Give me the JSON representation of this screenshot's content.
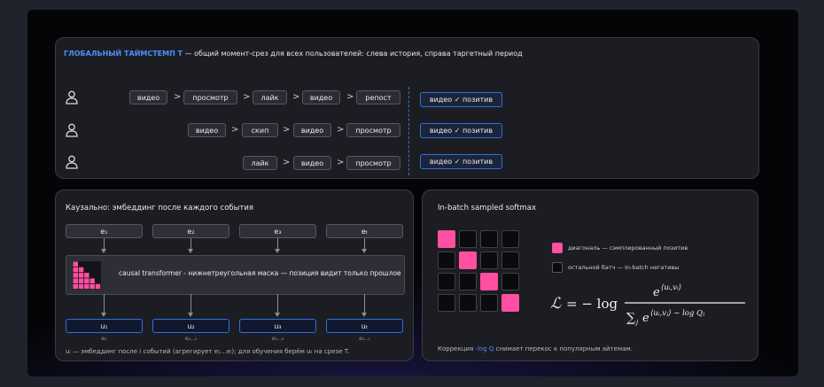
{
  "header": {
    "accent": "ГЛОБАЛЬНЫЙ ТАЙМСТЕМП T",
    "rest": " — общий момент-срез для всех пользователей: слева история, справа таргетный период"
  },
  "users": [
    {
      "events": [
        "видео",
        "просмотр",
        "лайк",
        "видео",
        "репост"
      ],
      "target": "видео ✓ позитив"
    },
    {
      "events": [
        "видео",
        "скип",
        "видео",
        "просмотр"
      ],
      "target": "видео ✓ позитив"
    },
    {
      "events": [
        "лайк",
        "видео",
        "просмотр"
      ],
      "target": "видео ✓ позитив"
    }
  ],
  "causal": {
    "title": "Каузально: эмбеддинг после каждого события",
    "inputs": [
      "e₁",
      "e₂",
      "e₃",
      "eₜ"
    ],
    "transformer_label": "causal transformer - нижнетреугольная маска — позиция видит только прошлое",
    "outputs": [
      "u₁",
      "u₂",
      "u₃",
      "uₜ"
    ],
    "output_subs": [
      "e₁",
      "e₁..₂",
      "e₁..₃",
      "e₁..ₜ"
    ],
    "footer": "uᵢ — эмбеддинг после i событий (агрегирует e₁…eᵢ); для обучения берём uₜ на срезе T."
  },
  "softmax": {
    "title": "In-batch sampled softmax",
    "grid_size": 4,
    "legend": [
      {
        "color": "#ff4fa0",
        "label": "диагональ — сэмплированный позитив"
      },
      {
        "color": "#0b0b0e",
        "label": "остальной батч — in-batch негативы"
      }
    ],
    "footer_pre": "Коррекция ",
    "footer_accent": "-log Q",
    "footer_post": " снимает перекос к популярным айтемам."
  },
  "colors": {
    "accent": "#4d8dff",
    "positive": "#ff4fa0",
    "target_border": "#2f6fe0"
  }
}
